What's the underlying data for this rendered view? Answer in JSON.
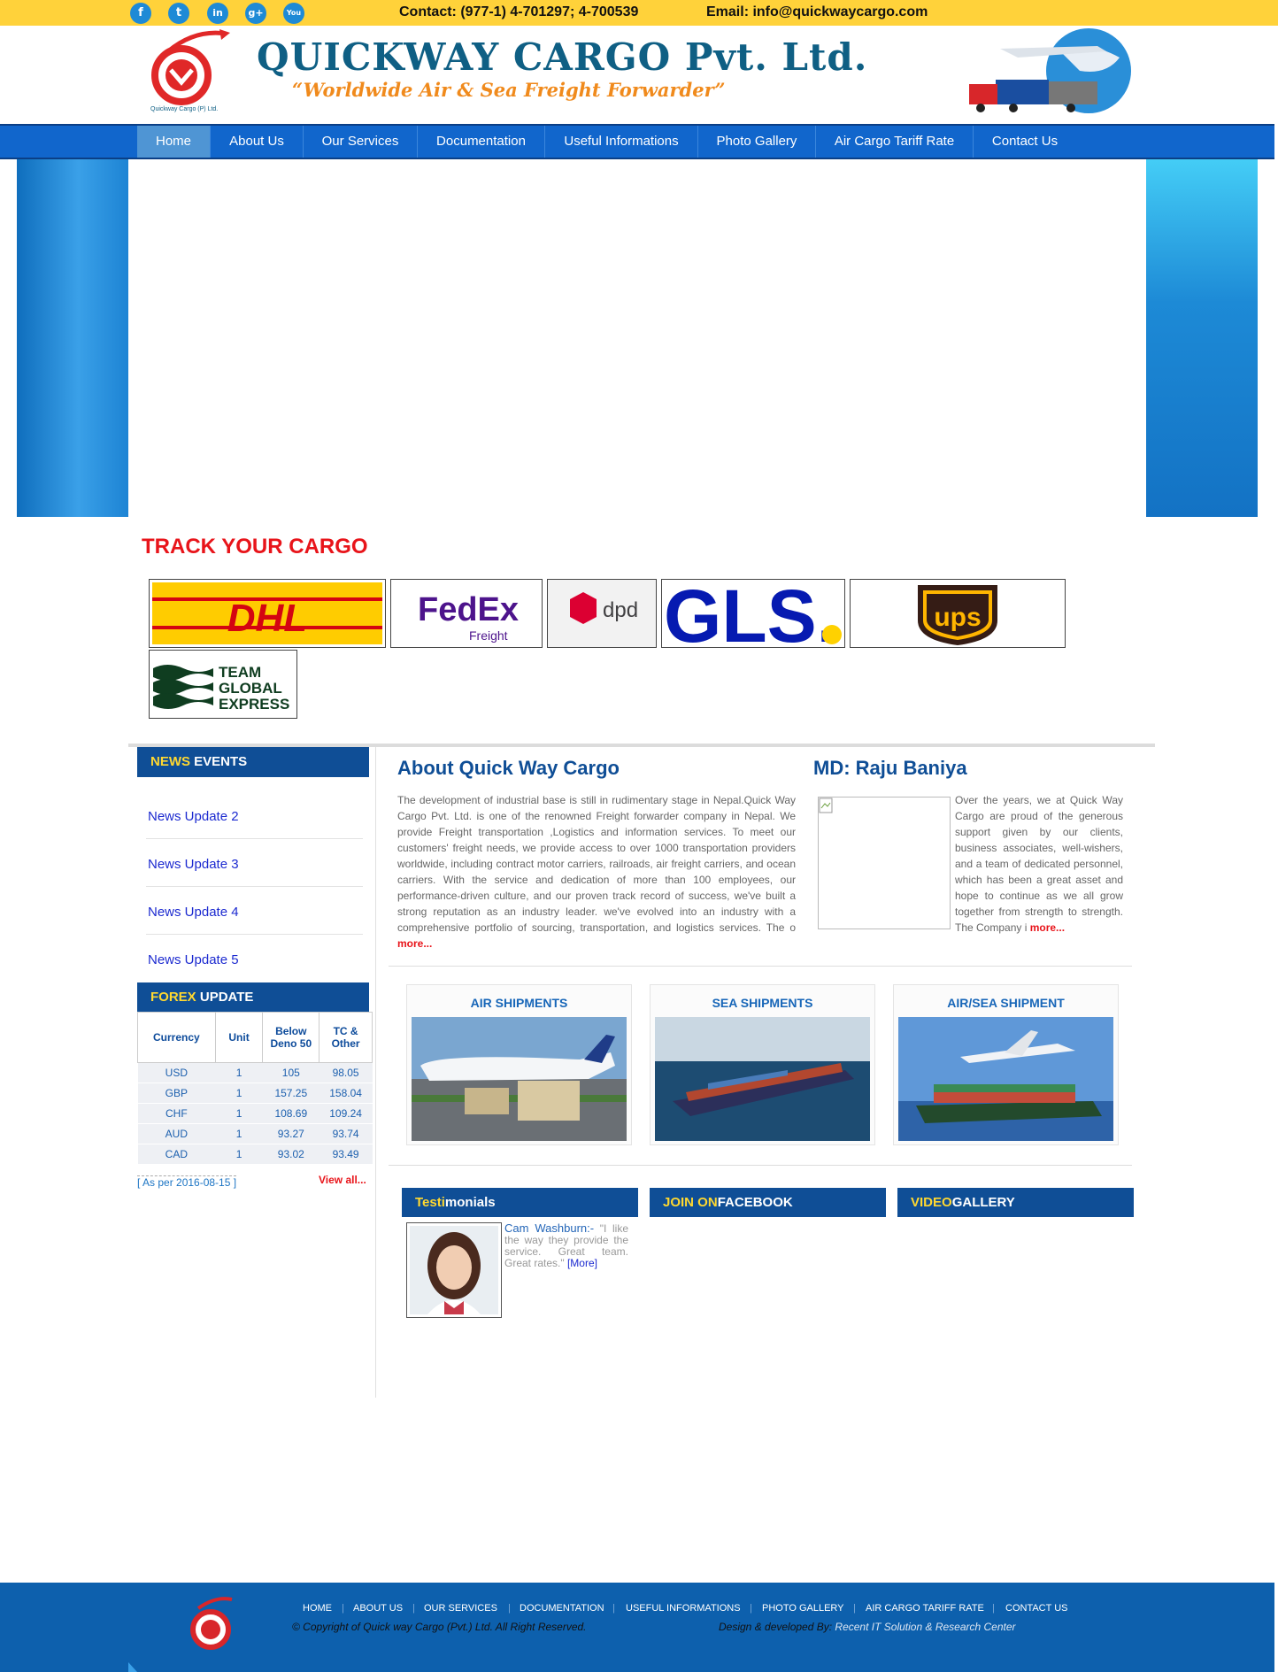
{
  "topbar": {
    "social": [
      {
        "icon": "facebook-icon",
        "glyph": "f"
      },
      {
        "icon": "twitter-icon",
        "glyph": "t"
      },
      {
        "icon": "linkedin-icon",
        "glyph": "in"
      },
      {
        "icon": "googleplus-icon",
        "glyph": "g+"
      },
      {
        "icon": "youtube-icon",
        "glyph": "You"
      }
    ],
    "contact": "Contact: (977-1) 4-701297; 4-700539",
    "email": "Email: info@quickwaycargo.com"
  },
  "header": {
    "company": "QUICKWAY CARGO Pvt. Ltd.",
    "tagline": "“Worldwide Air & Sea Freight Forwarder”",
    "logo_text": "Quickway Cargo (P) Ltd."
  },
  "nav": [
    "Home",
    "About Us",
    "Our Services",
    "Documentation",
    "Useful Informations",
    "Photo Gallery",
    "Air Cargo Tariff Rate",
    "Contact Us"
  ],
  "track": {
    "title": "TRACK YOUR CARGO",
    "carriers": [
      "DHL",
      "FedEx",
      "Freight",
      "dpd",
      "GLS.",
      "ups",
      "TEAM",
      "GLOBAL",
      "EXPRESS"
    ]
  },
  "news": {
    "head_hl": "NEWS",
    "head": " EVENTS",
    "items": [
      "News Update 2",
      "News Update 3",
      "News Update 4",
      "News Update 5"
    ]
  },
  "forex": {
    "head_hl": "FOREX",
    "head": " UPDATE",
    "columns": [
      "Currency",
      "Unit",
      "Below Deno 50",
      "TC & Other"
    ],
    "rows": [
      [
        "USD",
        "1",
        "105",
        "98.05"
      ],
      [
        "GBP",
        "1",
        "157.25",
        "158.04"
      ],
      [
        "CHF",
        "1",
        "108.69",
        "109.24"
      ],
      [
        "AUD",
        "1",
        "93.27",
        "93.74"
      ],
      [
        "CAD",
        "1",
        "93.02",
        "93.49"
      ]
    ],
    "as_per": "[ As per 2016-08-15 ]",
    "view_all": "View all..."
  },
  "about": {
    "title": "About Quick Way Cargo",
    "text": "The development of industrial base is still in rudimentary stage in Nepal.Quick Way Cargo Pvt. Ltd. is one of the renowned Freight forwarder company in Nepal. We provide Freight transportation ,Logistics and information services. To meet our customers' freight needs, we provide access to over 1000 transportation providers worldwide, including contract motor carriers, railroads, air freight carriers, and ocean carriers. With the service and dedication of more than 100 employees, our performance-driven culture, and our proven track record of success, we've built a strong reputation as an industry leader. we've evolved into an industry with a comprehensive portfolio of sourcing, transportation, and logistics services. The o ",
    "more": "more..."
  },
  "md": {
    "title": "MD: Raju Baniya",
    "text": "Over the years, we at Quick Way Cargo are proud of the generous support given by our clients, business associates, well-wishers, and a team of dedicated personnel, which has been a great asset and hope to continue as we all grow together from strength to strength. The Company i ",
    "more": "more..."
  },
  "shipments": [
    "AIR SHIPMENTS",
    "SEA SHIPMENTS",
    "AIR/SEA SHIPMENT"
  ],
  "bottom_heads": [
    {
      "hl": "Testi",
      "rest": "monials"
    },
    {
      "hl": "JOIN ON",
      "rest": "FACEBOOK"
    },
    {
      "hl": "VIDEO",
      "rest": "GALLERY"
    }
  ],
  "testimonial": {
    "name": "Cam Washburn:-",
    "quote": " \"I like the way they provide the service. Great team. Great rates.\" ",
    "more": "[More]"
  },
  "footer": {
    "links": [
      "HOME",
      "ABOUT US",
      "OUR SERVICES",
      "DOCUMENTATION",
      "USEFUL INFORMATIONS",
      "PHOTO GALLERY",
      "AIR CARGO TARIFF RATE",
      "CONTACT US"
    ],
    "copyright": "© Copyright of Quick way Cargo (Pvt.) Ltd. All Right Reserved.",
    "design_label": "Design & developed By: ",
    "designer": "Recent IT Solution & Research Center"
  },
  "colors": {
    "topbar": "#ffd23a",
    "nav": "#1166cc",
    "title_blue": "#0f4e96",
    "accent_red": "#e8141a",
    "footer": "#0d60ad"
  }
}
